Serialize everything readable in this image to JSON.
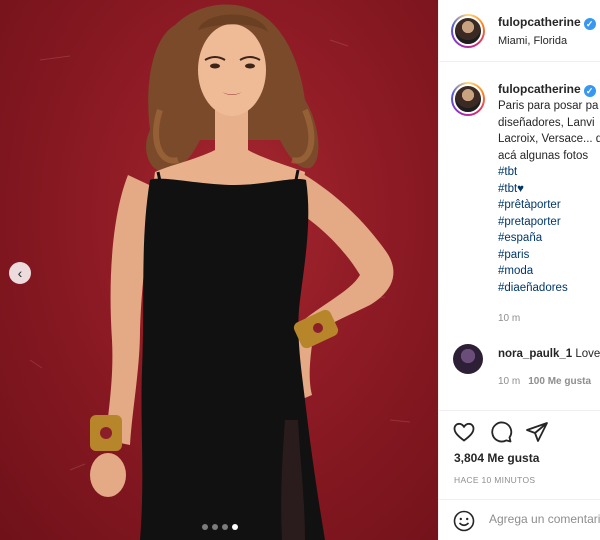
{
  "post": {
    "username": "fulopcatherine",
    "location": "Miami, Florida",
    "caption_lines": [
      "Paris para posar pa",
      "diseñadores, Lanvi",
      "Lacroix, Versace... d",
      "acá algunas fotos"
    ],
    "hashtags": [
      "#tbt",
      "#tbt♥",
      "#prêtàporter",
      "#pretaporter",
      "#españa",
      "#paris",
      "#moda",
      "#diaeñadores"
    ],
    "caption_time": "10 m"
  },
  "comment": {
    "username": "nora_paulk_1",
    "text": "Love",
    "time": "10 m",
    "likes": "100 Me gusta"
  },
  "actions": {
    "like_icon": "heart-outline-icon",
    "comment_icon": "speech-bubble-icon",
    "share_icon": "paper-plane-icon",
    "likes_count": "3,804 Me gusta",
    "posted_ago": "HACE 10 MINUTOS",
    "comment_placeholder": "Agrega un comentario",
    "emoji_icon": "smiley-icon"
  },
  "carousel": {
    "slides": 4,
    "active_slide": 4,
    "prev_icon": "chevron-left-icon"
  },
  "colors": {
    "verified": "#3897f0",
    "hashtag": "#00376b",
    "backdrop": "#8c1a24",
    "muted": "#8e8e8e"
  }
}
